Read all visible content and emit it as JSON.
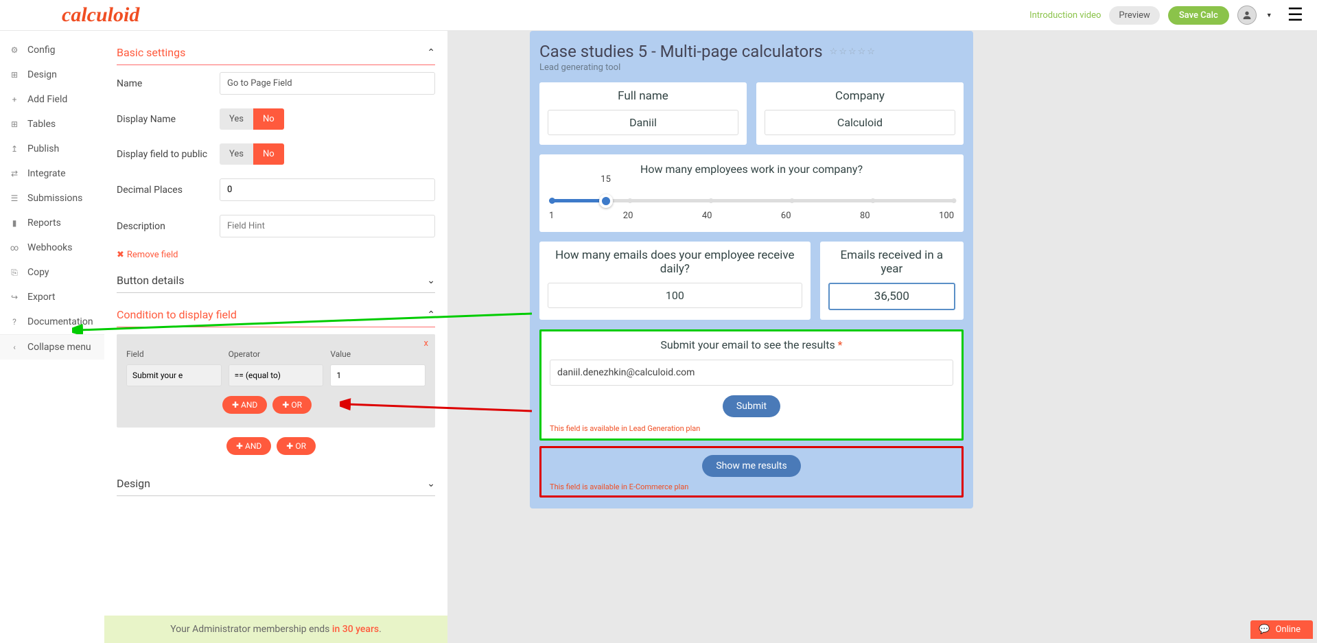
{
  "topbar": {
    "logo": "calculoid",
    "intro_video": "Introduction video",
    "preview": "Preview",
    "save": "Save Calc"
  },
  "sidebar": {
    "items": [
      {
        "label": "Config",
        "icon": "⚙"
      },
      {
        "label": "Design",
        "icon": "⊞"
      },
      {
        "label": "Add Field",
        "icon": "+"
      },
      {
        "label": "Tables",
        "icon": "⊞"
      },
      {
        "label": "Publish",
        "icon": "↥"
      },
      {
        "label": "Integrate",
        "icon": "⇄"
      },
      {
        "label": "Submissions",
        "icon": "☰"
      },
      {
        "label": "Reports",
        "icon": "▮"
      },
      {
        "label": "Webhooks",
        "icon": "∞"
      },
      {
        "label": "Copy",
        "icon": "⎘"
      },
      {
        "label": "Export",
        "icon": "↪"
      },
      {
        "label": "Documentation",
        "icon": "?"
      }
    ],
    "collapse": "Collapse menu"
  },
  "editor": {
    "basic_settings": "Basic settings",
    "name_label": "Name",
    "name_value": "Go to Page Field",
    "display_name_label": "Display Name",
    "display_public_label": "Display field to public",
    "yes": "Yes",
    "no": "No",
    "decimal_label": "Decimal Places",
    "decimal_value": "0",
    "description_label": "Description",
    "description_placeholder": "Field Hint",
    "remove_field": "Remove field",
    "button_details": "Button details",
    "condition_header": "Condition to display field",
    "field_label": "Field",
    "operator_label": "Operator",
    "value_label": "Value",
    "field_value": "Submit your e",
    "operator_value": "== (equal to)",
    "value_value": "1",
    "close_x": "x",
    "and": "AND",
    "or": "OR",
    "design": "Design"
  },
  "footer": {
    "text": "Your Administrator membership ends ",
    "highlight": "in 30 years",
    "period": "."
  },
  "calculator": {
    "title": "Case studies 5 - Multi-page calculators",
    "subtitle": "Lead generating tool",
    "fullname_label": "Full name",
    "fullname_value": "Daniil",
    "company_label": "Company",
    "company_value": "Calculoid",
    "employees_label": "How many employees work in your company?",
    "slider_value": "15",
    "slider_marks": [
      "1",
      "20",
      "40",
      "60",
      "80",
      "100"
    ],
    "emails_daily_label": "How many emails does your employee receive daily?",
    "emails_daily_value": "100",
    "emails_year_label": "Emails received in a year",
    "emails_year_value": "36,500",
    "submit_label": "Submit your email to see the results ",
    "submit_req": "*",
    "email_value": "daniil.denezhkin@calculoid.com",
    "submit_btn": "Submit",
    "submit_plan": "This field is available in Lead Generation plan",
    "show_btn": "Show me results",
    "show_plan": "This field is available in E-Commerce plan"
  },
  "online": "Online"
}
